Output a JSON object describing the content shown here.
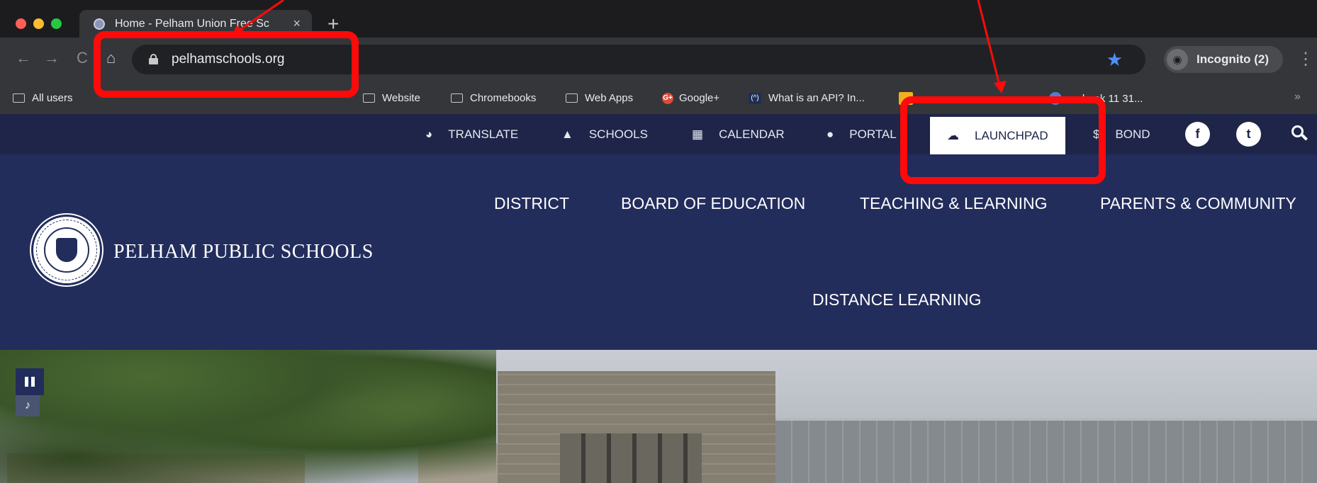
{
  "browser": {
    "tab_title": "Home - Pelham Union Free Sc",
    "tab_close": "×",
    "new_tab": "+",
    "url": "pelhamschools.org",
    "incognito_label": "Incognito (2)",
    "back_icon": "←",
    "forward_icon": "→",
    "reload_icon": "C",
    "home_icon": "⌂",
    "star_icon": "★",
    "menu_icon": "⋮",
    "bookmarks": {
      "items": [
        "All users",
        "Website",
        "Chromebooks",
        "Web Apps",
        "Google+",
        "What is an API? In...",
        "mebook 11 31..."
      ],
      "more": "»"
    }
  },
  "site": {
    "topbar": {
      "translate": "TRANSLATE",
      "schools": "SCHOOLS",
      "calendar": "CALENDAR",
      "portal": "PORTAL",
      "launchpad": "LAUNCHPAD",
      "bond": "BOND",
      "facebook": "f",
      "twitter": "t"
    },
    "title": "PELHAM PUBLIC SCHOOLS",
    "seal_text": "PELHAM PUBLIC SCHOOLS",
    "main_nav": {
      "district": "DISTRICT",
      "board": "BOARD OF EDUCATION",
      "teaching": "TEACHING & LEARNING",
      "parents": "PARENTS & COMMUNITY",
      "distance": "DISTANCE LEARNING"
    }
  },
  "colors": {
    "topbar": "#1e2548",
    "header": "#222d5c",
    "annotation": "#ff0a0a"
  }
}
